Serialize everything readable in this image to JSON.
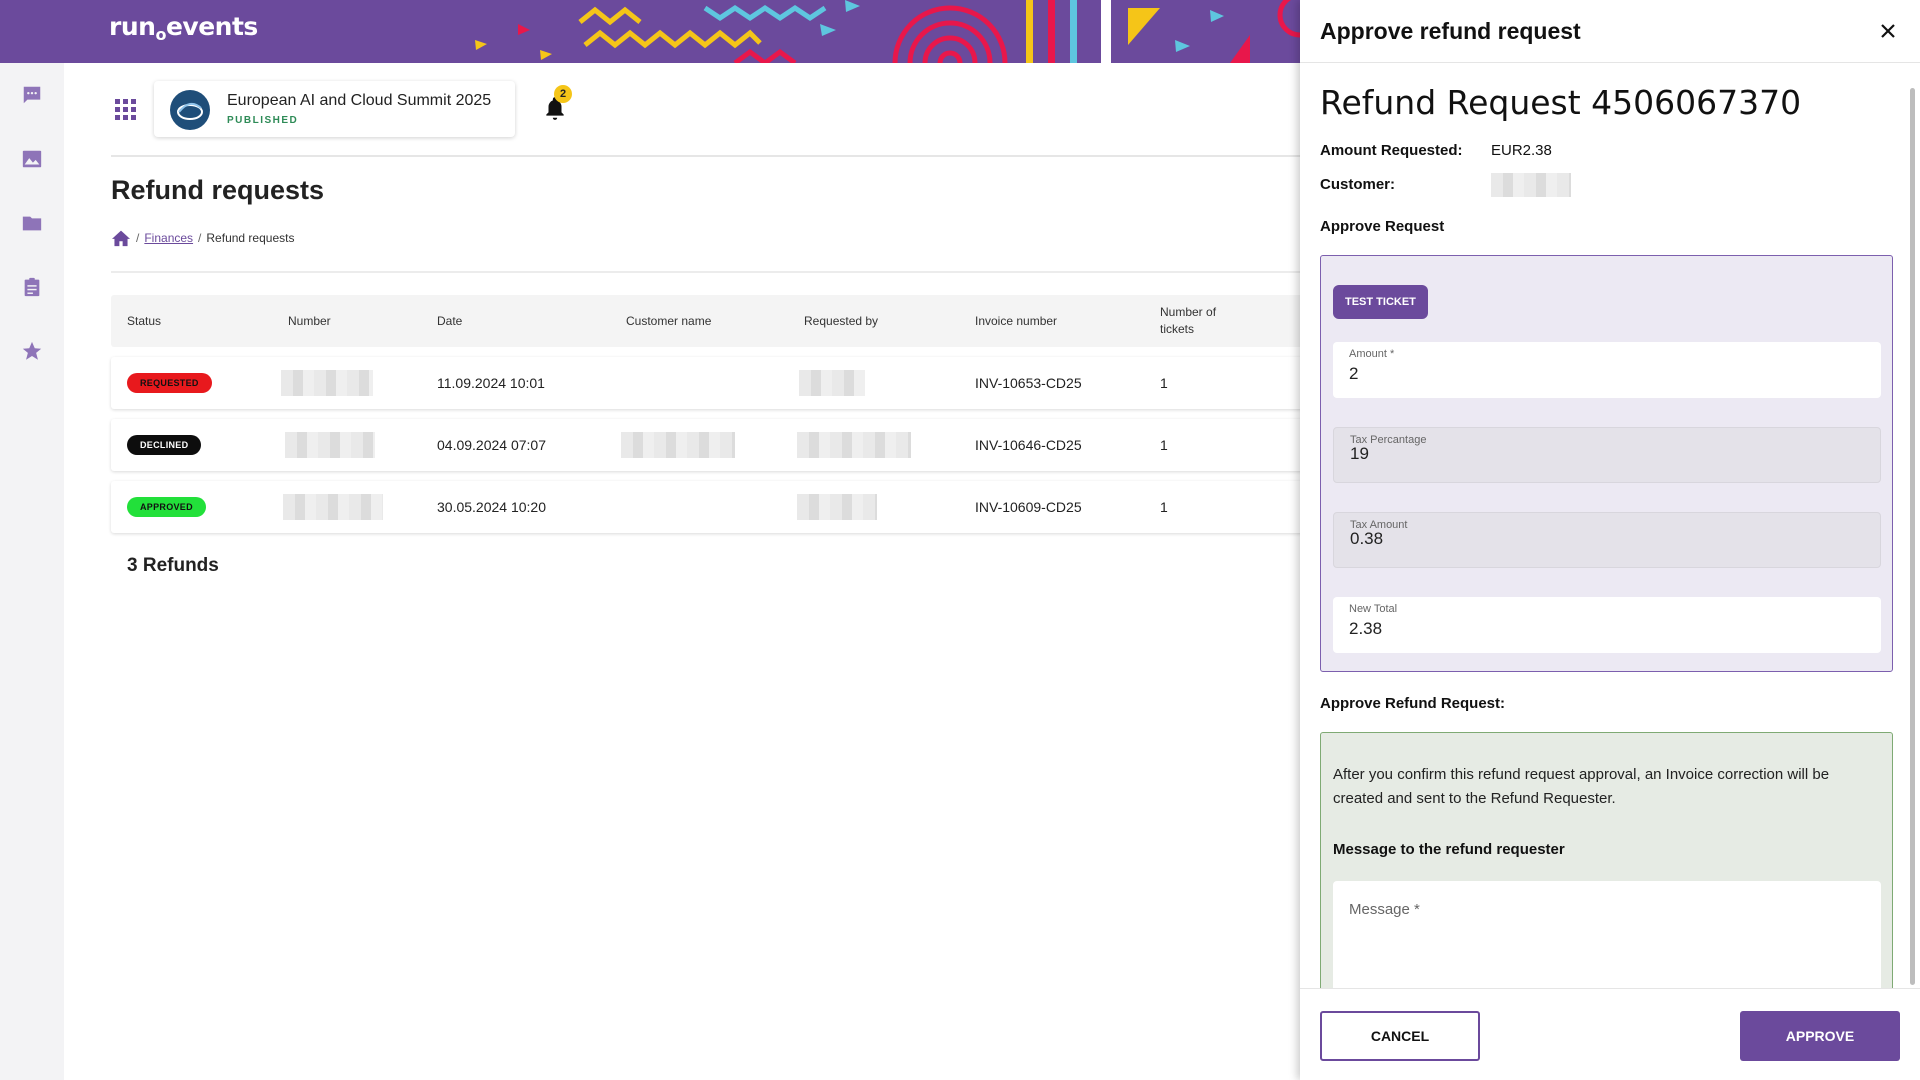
{
  "brand": {
    "logo_text": "run",
    "logo_dot": "o",
    "logo_text2": "events",
    "accent_color": "#6b4a9c"
  },
  "rail": {
    "icons": [
      "chat-icon",
      "image-icon",
      "folder-icon",
      "clipboard-icon",
      "star-icon"
    ]
  },
  "header": {
    "event_name": "European AI and Cloud Summit 2025",
    "event_status": "PUBLISHED",
    "notification_count": "2"
  },
  "page": {
    "title": "Refund requests",
    "breadcrumb": {
      "sep1": "/",
      "finances": "Finances",
      "sep2": "/",
      "current": "Refund requests"
    }
  },
  "table": {
    "headers": {
      "status": "Status",
      "number": "Number",
      "date": "Date",
      "customer_name": "Customer name",
      "requested_by": "Requested by",
      "invoice_number": "Invoice number",
      "tickets_line1": "Number of",
      "tickets_line2": "tickets"
    },
    "rows": [
      {
        "status": "REQUESTED",
        "date": "11.09.2024 10:01",
        "invoice": "INV-10653-CD25",
        "tickets": "1"
      },
      {
        "status": "DECLINED",
        "date": "04.09.2024 07:07",
        "invoice": "INV-10646-CD25",
        "tickets": "1"
      },
      {
        "status": "APPROVED",
        "date": "30.05.2024 10:20",
        "invoice": "INV-10609-CD25",
        "tickets": "1"
      }
    ],
    "count_label": "3 Refunds"
  },
  "drawer": {
    "title": "Approve refund request",
    "request_title": "Refund Request 4506067370",
    "amount_label": "Amount Requested:",
    "amount_value": "EUR2.38",
    "customer_label": "Customer:",
    "approve_section": "Approve Request",
    "ticket_tag": "TEST TICKET",
    "fields": {
      "amount_label": "Amount *",
      "amount_value": "2",
      "tax_pct_label": "Tax Percantage",
      "tax_pct_value": "19",
      "tax_amount_label": "Tax Amount",
      "tax_amount_value": "0.38",
      "new_total_label": "New Total",
      "new_total_value": "2.38"
    },
    "confirm_section": "Approve Refund Request:",
    "confirm_text": "After you confirm this refund request approval, an Invoice correction will be created and sent to the Refund Requester.",
    "message_label": "Message to the refund requester",
    "message_placeholder": "Message *",
    "cancel_label": "CANCEL",
    "approve_label": "APPROVE"
  }
}
